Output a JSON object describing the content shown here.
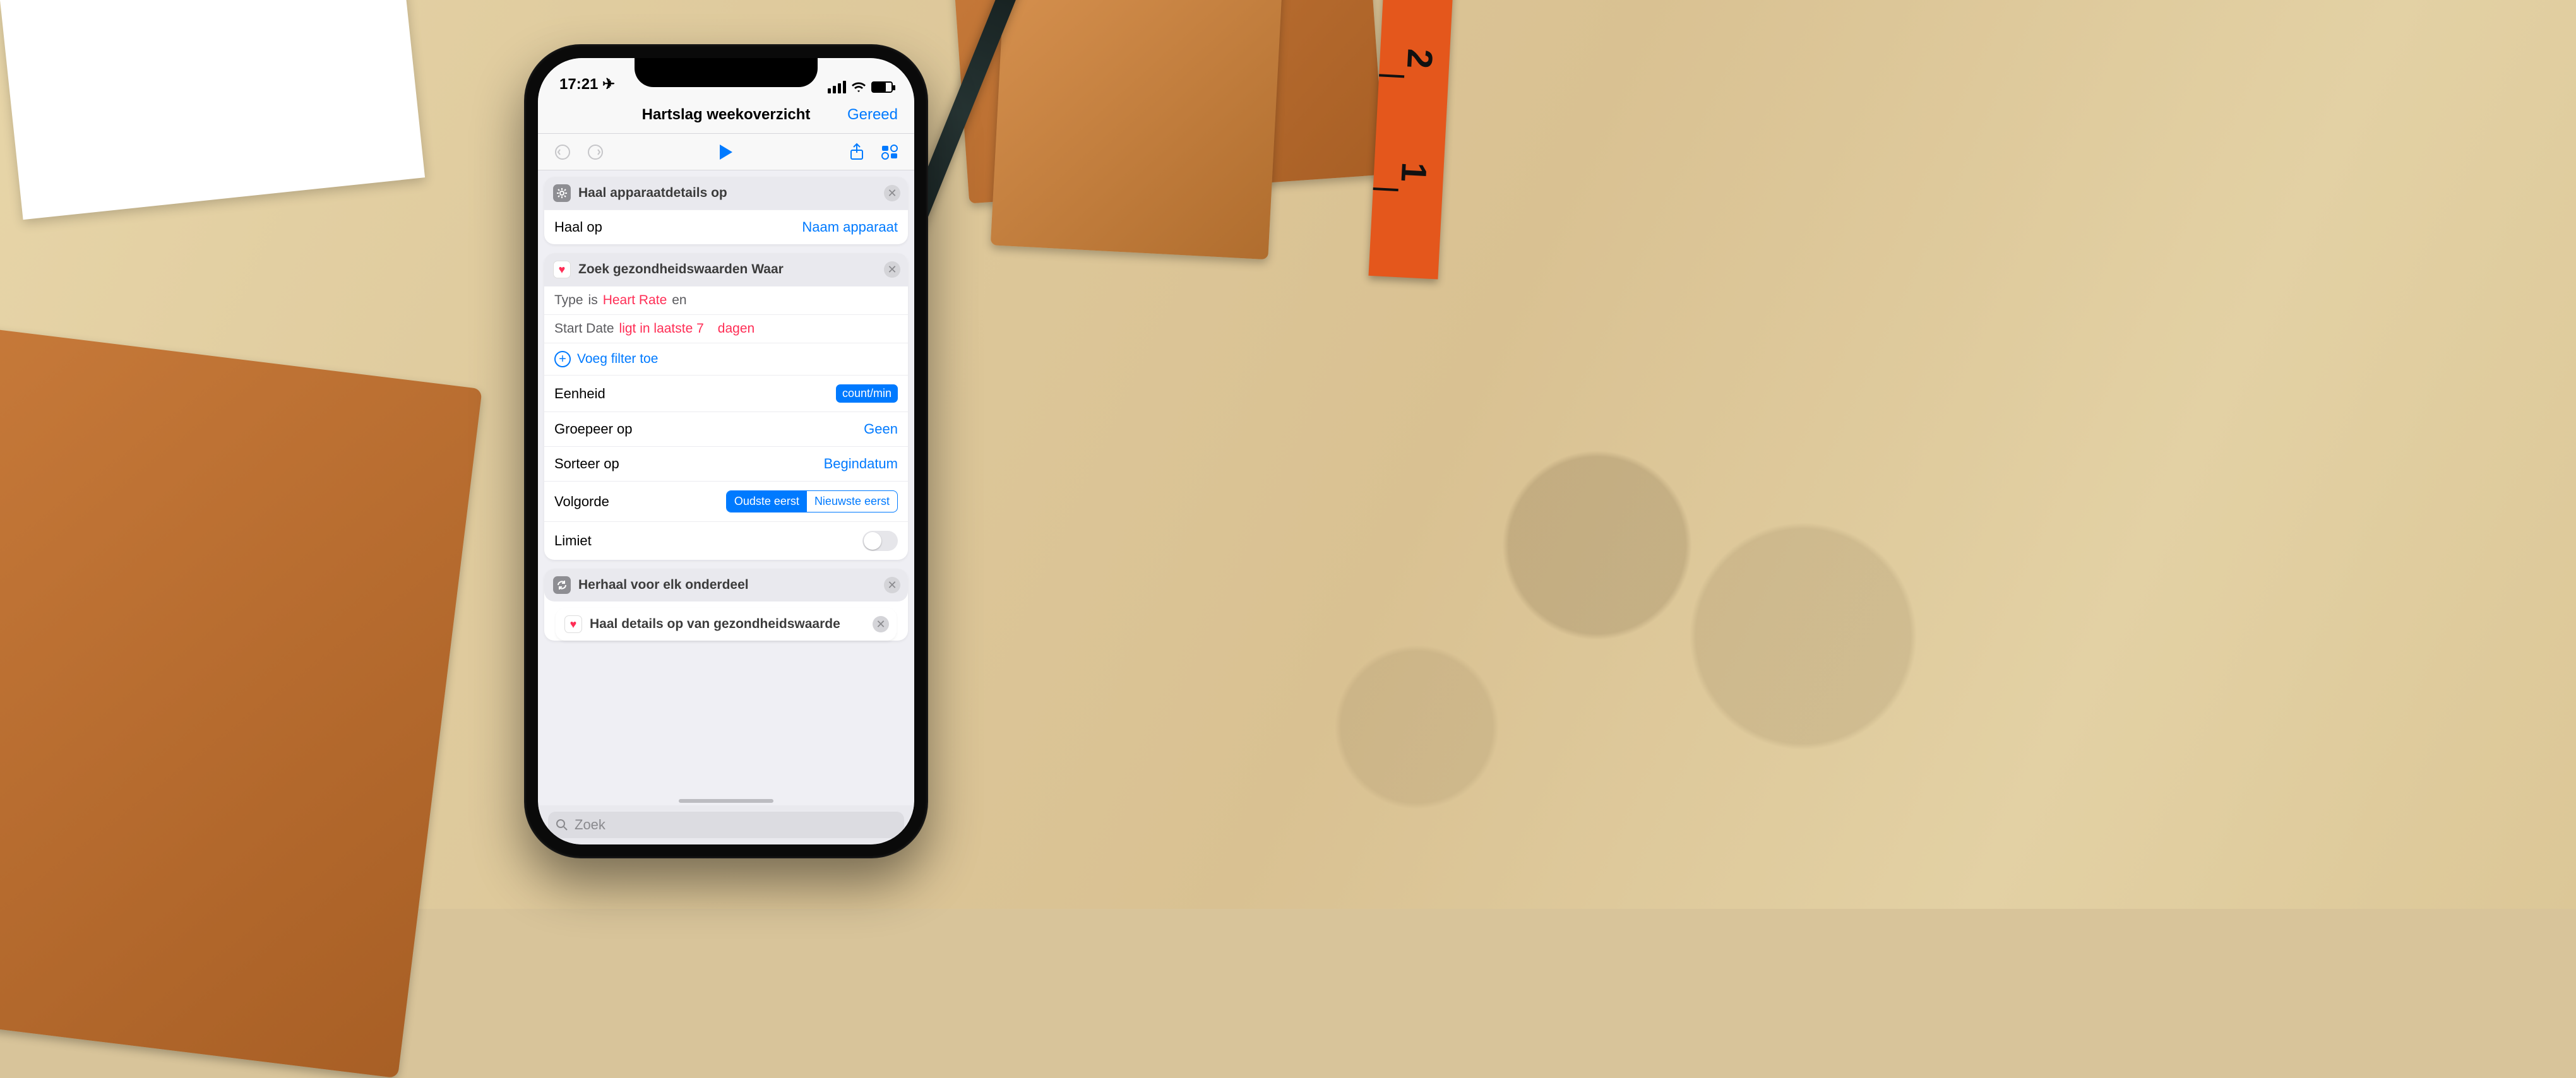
{
  "ruler": {
    "n1": "2",
    "n2": "1"
  },
  "status": {
    "time": "17:21 ✈︎"
  },
  "nav": {
    "title": "Hartslag weekoverzicht",
    "done": "Gereed"
  },
  "card1": {
    "title": "Haal apparaatdetails op",
    "row_label": "Haal op",
    "row_value": "Naam apparaat"
  },
  "card2": {
    "title": "Zoek gezondheidswaarden Waar",
    "p1": {
      "a": "Type",
      "b": "is",
      "c": "Heart Rate",
      "d": "en"
    },
    "p2": {
      "a": "Start Date",
      "b": "ligt in laatste 7",
      "c": "dagen"
    },
    "add": "Voeg filter toe",
    "r_unit": {
      "label": "Eenheid",
      "badge": "count/min"
    },
    "r_group": {
      "label": "Groepeer op",
      "value": "Geen"
    },
    "r_sort": {
      "label": "Sorteer op",
      "value": "Begindatum"
    },
    "r_order": {
      "label": "Volgorde",
      "opt1": "Oudste eerst",
      "opt2": "Nieuwste eerst"
    },
    "r_limit": {
      "label": "Limiet"
    }
  },
  "card3": {
    "title": "Herhaal voor elk onderdeel"
  },
  "card4": {
    "title": "Haal details op van gezondheidswaarde"
  },
  "search": {
    "placeholder": "Zoek"
  }
}
